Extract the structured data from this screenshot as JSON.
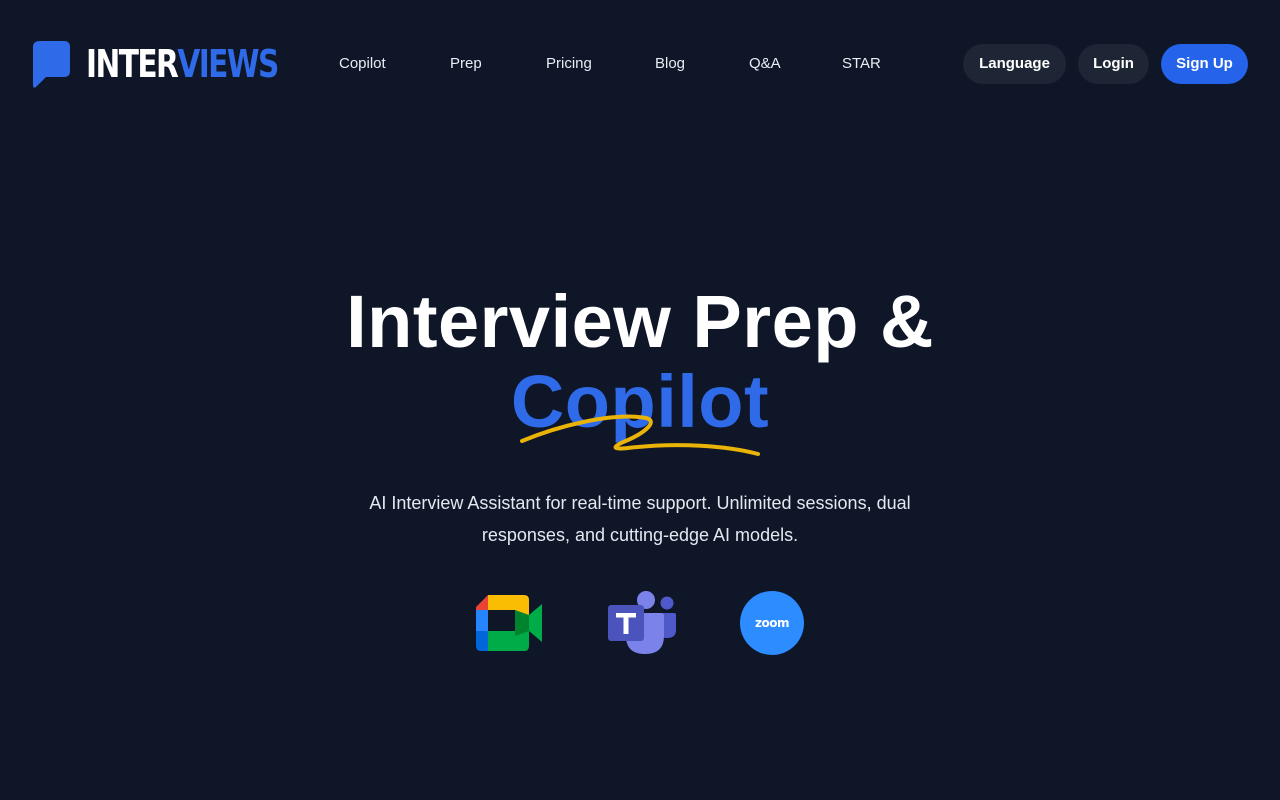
{
  "brand": {
    "name_part1": "INTER",
    "name_part2": "VIEWS",
    "logo_icon": "chat-bubble-icon",
    "colors": {
      "background": "#0e1628",
      "accent": "#2563eb",
      "highlight": "#eab308"
    }
  },
  "nav": {
    "items": [
      {
        "label": "Copilot"
      },
      {
        "label": "Prep"
      },
      {
        "label": "Pricing"
      },
      {
        "label": "Blog"
      },
      {
        "label": "Q&A"
      },
      {
        "label": "STAR"
      }
    ]
  },
  "header_actions": {
    "language_label": "Language",
    "login_label": "Login",
    "signup_label": "Sign Up"
  },
  "hero": {
    "title_line1": "Interview Prep &",
    "title_line2": "Copilot",
    "subtitle": "AI Interview Assistant for real-time support. Unlimited sessions, dual responses, and cutting-edge AI models."
  },
  "integrations": [
    {
      "name": "google-meet-icon"
    },
    {
      "name": "microsoft-teams-icon"
    },
    {
      "name": "zoom-icon",
      "label": "zoom"
    }
  ]
}
